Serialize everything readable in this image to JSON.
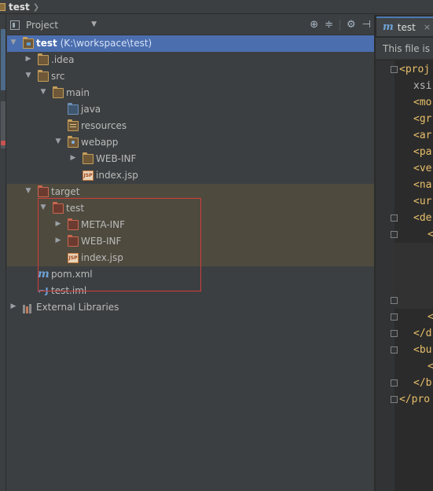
{
  "navbar": {
    "title": "test"
  },
  "project_panel": {
    "view_selector": "Project",
    "header_icons": [
      {
        "name": "locate-icon",
        "glyph": "⊕"
      },
      {
        "name": "collapse-all-icon",
        "glyph": "≑"
      },
      {
        "name": "settings-icon",
        "glyph": "⚙"
      },
      {
        "name": "hide-icon",
        "glyph": "⊣"
      }
    ]
  },
  "tree": [
    {
      "label": "test",
      "hint": "(K:\\workspace\\test)",
      "depth": 0,
      "arrow": "down",
      "icon": "module",
      "state": "selected"
    },
    {
      "label": ".idea",
      "depth": 1,
      "arrow": "right",
      "icon": "folder"
    },
    {
      "label": "src",
      "depth": 1,
      "arrow": "down",
      "icon": "folder"
    },
    {
      "label": "main",
      "depth": 2,
      "arrow": "down",
      "icon": "folder"
    },
    {
      "label": "java",
      "depth": 3,
      "arrow": "none",
      "icon": "source"
    },
    {
      "label": "resources",
      "depth": 3,
      "arrow": "none",
      "icon": "resources"
    },
    {
      "label": "webapp",
      "depth": 3,
      "arrow": "down",
      "icon": "web"
    },
    {
      "label": "WEB-INF",
      "depth": 4,
      "arrow": "right",
      "icon": "folder"
    },
    {
      "label": "index.jsp",
      "depth": 4,
      "arrow": "none",
      "icon": "jsp"
    },
    {
      "label": "target",
      "depth": 1,
      "arrow": "down",
      "icon": "excluded",
      "state": "highlight"
    },
    {
      "label": "test",
      "depth": 2,
      "arrow": "down",
      "icon": "excluded",
      "state": "highlight"
    },
    {
      "label": "META-INF",
      "depth": 3,
      "arrow": "right",
      "icon": "excluded",
      "state": "highlight"
    },
    {
      "label": "WEB-INF",
      "depth": 3,
      "arrow": "right",
      "icon": "excluded",
      "state": "highlight"
    },
    {
      "label": "index.jsp",
      "depth": 3,
      "arrow": "none",
      "icon": "jsp",
      "state": "highlight"
    },
    {
      "label": "pom.xml",
      "depth": 1,
      "arrow": "none",
      "icon": "maven"
    },
    {
      "label": "test.iml",
      "depth": 1,
      "arrow": "none",
      "icon": "iml"
    },
    {
      "label": "External Libraries",
      "depth": 0,
      "arrow": "right",
      "icon": "libraries"
    }
  ],
  "editor": {
    "tab_label": "test",
    "tab_icon": "m",
    "tab_close": "×",
    "banner": "This file is i",
    "code_lines": [
      {
        "text": "<proj",
        "indent": 0,
        "kind": "tag",
        "fold": true
      },
      {
        "text": "xsi",
        "indent": 1,
        "kind": "attr"
      },
      {
        "text": "<mo",
        "indent": 1,
        "kind": "tag"
      },
      {
        "text": "<gr",
        "indent": 1,
        "kind": "tag"
      },
      {
        "text": "<ar",
        "indent": 1,
        "kind": "tag"
      },
      {
        "text": "<pa",
        "indent": 1,
        "kind": "tag"
      },
      {
        "text": "<ve",
        "indent": 1,
        "kind": "tag"
      },
      {
        "text": "<na",
        "indent": 1,
        "kind": "tag"
      },
      {
        "text": "<ur",
        "indent": 1,
        "kind": "tag"
      },
      {
        "text": "<de",
        "indent": 1,
        "kind": "tag",
        "fold": true
      },
      {
        "text": "<",
        "indent": 2,
        "kind": "tag",
        "fold": true
      },
      {
        "text": "",
        "indent": 0,
        "kind": "tag"
      },
      {
        "text": "",
        "indent": 0,
        "kind": "tag"
      },
      {
        "text": "",
        "indent": 0,
        "kind": "tag"
      },
      {
        "text": "",
        "indent": 0,
        "kind": "tag",
        "fold": true
      },
      {
        "text": "<",
        "indent": 2,
        "kind": "tag",
        "fold": true
      },
      {
        "text": "</d",
        "indent": 1,
        "kind": "tag",
        "fold": true
      },
      {
        "text": "<bu",
        "indent": 1,
        "kind": "tag",
        "fold": true
      },
      {
        "text": "<",
        "indent": 2,
        "kind": "tag"
      },
      {
        "text": "</b",
        "indent": 1,
        "kind": "tag",
        "fold": true
      },
      {
        "text": "</pro",
        "indent": 0,
        "kind": "tag",
        "fold": true
      }
    ]
  },
  "colors": {
    "selection": "#4b6eaf",
    "excluded_highlight": "#4e4a3e",
    "annotation_box": "#d23c3c",
    "xml_tag": "#e8bf6a"
  }
}
